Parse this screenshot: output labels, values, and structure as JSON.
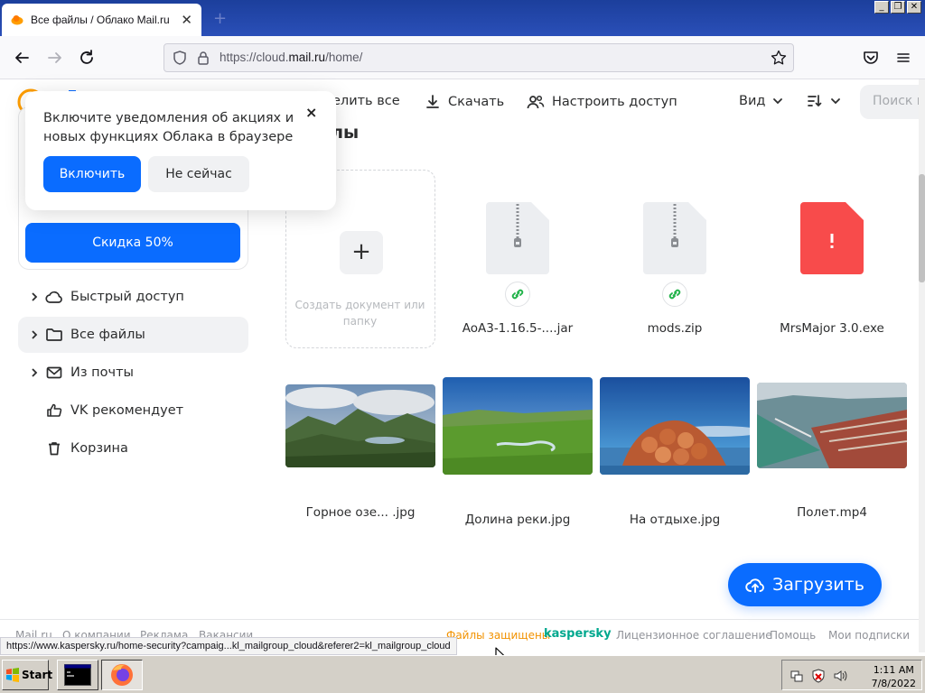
{
  "browser": {
    "tab_title": "Все файлы / Облако Mail.ru",
    "tab_close": "✕",
    "new_tab": "+",
    "url_prefix": "https://cloud.",
    "url_domain": "mail.ru",
    "url_path": "/home/",
    "window_buttons": [
      "_",
      "❐",
      "✕"
    ]
  },
  "toolbar": {
    "select_all": "елить все",
    "download": "Скачать",
    "share": "Настроить доступ",
    "view": "Вид",
    "search_placeholder": "Поиск в"
  },
  "popup": {
    "text": "Включите уведомления об акциях и новых функциях Облака в браузере",
    "close": "×",
    "enable": "Включить",
    "later": "Не сейчас"
  },
  "sidebar": {
    "discount_button": "Скидка 50%",
    "items": [
      {
        "label": "Быстрый доступ",
        "chevron": "›"
      },
      {
        "label": "Все файлы",
        "chevron": "›"
      },
      {
        "label": "Из почты",
        "chevron": "›"
      },
      {
        "label": "VK рекомендует",
        "chevron": ""
      },
      {
        "label": "Корзина",
        "chevron": ""
      }
    ]
  },
  "main": {
    "section_title": "айлы",
    "create_plus": "+",
    "create_text": "Создать документ или папку",
    "files": [
      {
        "name": "AoA3-1.16.5-....jar",
        "type": "archive",
        "shared": true
      },
      {
        "name": "mods.zip",
        "type": "archive",
        "shared": true
      },
      {
        "name": "MrsMajor 3.0.exe",
        "type": "exe",
        "shared": false,
        "badge": "!"
      },
      {
        "name": "Горное озе... .jpg",
        "type": "image",
        "shared": false
      },
      {
        "name": "Долина реки.jpg",
        "type": "image",
        "shared": false
      },
      {
        "name": "На отдыхе.jpg",
        "type": "image",
        "shared": false
      },
      {
        "name": "Полет.mp4",
        "type": "video",
        "shared": false
      }
    ],
    "upload_button": "Загрузить"
  },
  "footer": {
    "left_links": [
      "Mail.ru",
      "О компании",
      "Реклама",
      "Вакансии"
    ],
    "protected": "Файлы защищены",
    "kaspersky": "kaspersky",
    "right_links": [
      "Лицензионное соглашение",
      "Помощь",
      "Мои подписки"
    ]
  },
  "status_url": "https://www.kaspersky.ru/home-security?campaig...kl_mailgroup_cloud&referer2=kl_mailgroup_cloud",
  "taskbar": {
    "start": "Start",
    "time": "1:11 AM",
    "date": "7/8/2022"
  },
  "colors": {
    "accent": "#0a6cff",
    "exe_red": "#f84b4b",
    "kaspersky_green": "#00a88e",
    "protected_orange": "#f29200"
  }
}
